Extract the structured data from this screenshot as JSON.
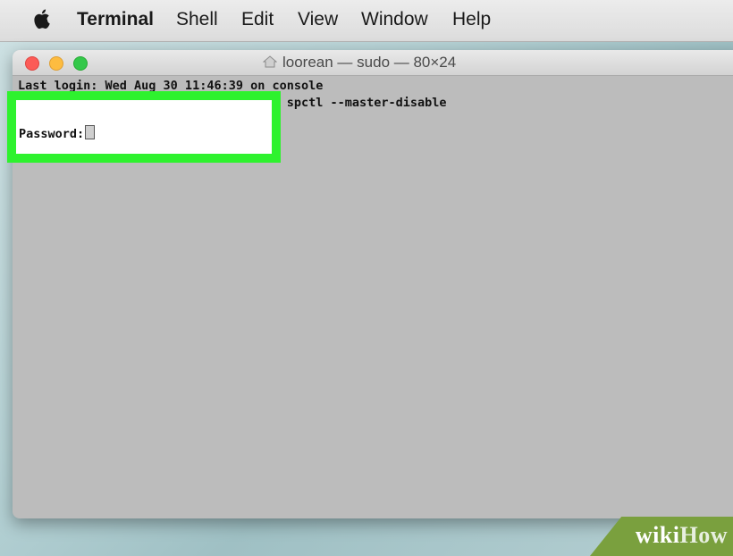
{
  "menubar": {
    "app_name": "Terminal",
    "items": [
      "Shell",
      "Edit",
      "View",
      "Window",
      "Help"
    ]
  },
  "window": {
    "title": "loorean — sudo — 80×24",
    "lines": [
      "Last login: Wed Aug 30 11:46:39 on console",
      "looreans-MacBook-Pro:~ loorean$ sudo spctl --master-disable"
    ],
    "prompt": "Password:"
  },
  "watermark": {
    "wiki": "wiki",
    "how": "How"
  },
  "colors": {
    "highlight": "#2ef22e",
    "traffic_red": "#fc5b57",
    "traffic_yellow": "#fdbc40",
    "traffic_green": "#34c84a"
  }
}
